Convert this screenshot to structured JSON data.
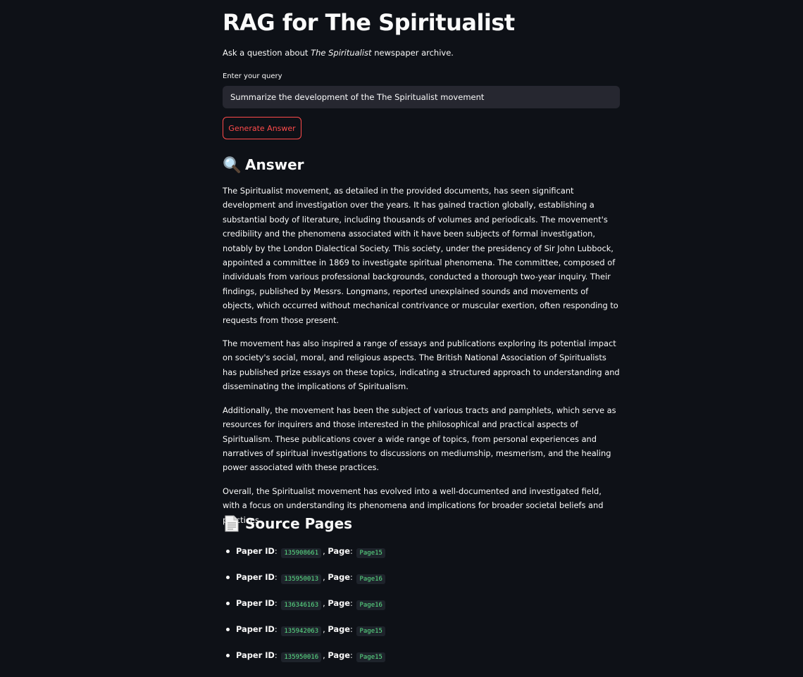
{
  "header": {
    "title": "RAG for The Spiritualist",
    "subtitle_prefix": "Ask a question about ",
    "subtitle_em": "The Spiritualist",
    "subtitle_suffix": " newspaper archive."
  },
  "query": {
    "label": "Enter your query",
    "value": "Summarize the development of the The Spiritualist movement"
  },
  "generate_button": {
    "label": "Generate Answer"
  },
  "answer": {
    "heading": "Answer",
    "icon": "magnifying-glass-icon",
    "paragraphs": [
      "The Spiritualist movement, as detailed in the provided documents, has seen significant development and investigation over the years. It has gained traction globally, establishing a substantial body of literature, including thousands of volumes and periodicals. The movement's credibility and the phenomena associated with it have been subjects of formal investigation, notably by the London Dialectical Society. This society, under the presidency of Sir John Lubbock, appointed a committee in 1869 to investigate spiritual phenomena. The committee, composed of individuals from various professional backgrounds, conducted a thorough two-year inquiry. Their findings, published by Messrs. Longmans, reported unexplained sounds and movements of objects, which occurred without mechanical contrivance or muscular exertion, often responding to requests from those present.",
      "The movement has also inspired a range of essays and publications exploring its potential impact on society's social, moral, and religious aspects. The British National Association of Spiritualists has published prize essays on these topics, indicating a structured approach to understanding and disseminating the implications of Spiritualism.",
      "Additionally, the movement has been the subject of various tracts and pamphlets, which serve as resources for inquirers and those interested in the philosophical and practical aspects of Spiritualism. These publications cover a wide range of topics, from personal experiences and narratives of spiritual investigations to discussions on mediumship, mesmerism, and the healing power associated with these practices.",
      "Overall, the Spiritualist movement has evolved into a well-documented and investigated field, with a focus on understanding its phenomena and implications for broader societal beliefs and practices."
    ]
  },
  "sources": {
    "heading": "Source Pages",
    "icon": "page-document-icon",
    "paper_label": "Paper ID",
    "page_label": "Page",
    "items": [
      {
        "paper_id": "135908661",
        "page": "Page15"
      },
      {
        "paper_id": "135950013",
        "page": "Page16"
      },
      {
        "paper_id": "136346163",
        "page": "Page16"
      },
      {
        "paper_id": "135942063",
        "page": "Page15"
      },
      {
        "paper_id": "135950016",
        "page": "Page15"
      }
    ]
  },
  "colors": {
    "background": "#0e1117",
    "text": "#fafafa",
    "input_bg": "#262730",
    "accent": "#ff4b4b",
    "code_text": "#5ce488"
  }
}
